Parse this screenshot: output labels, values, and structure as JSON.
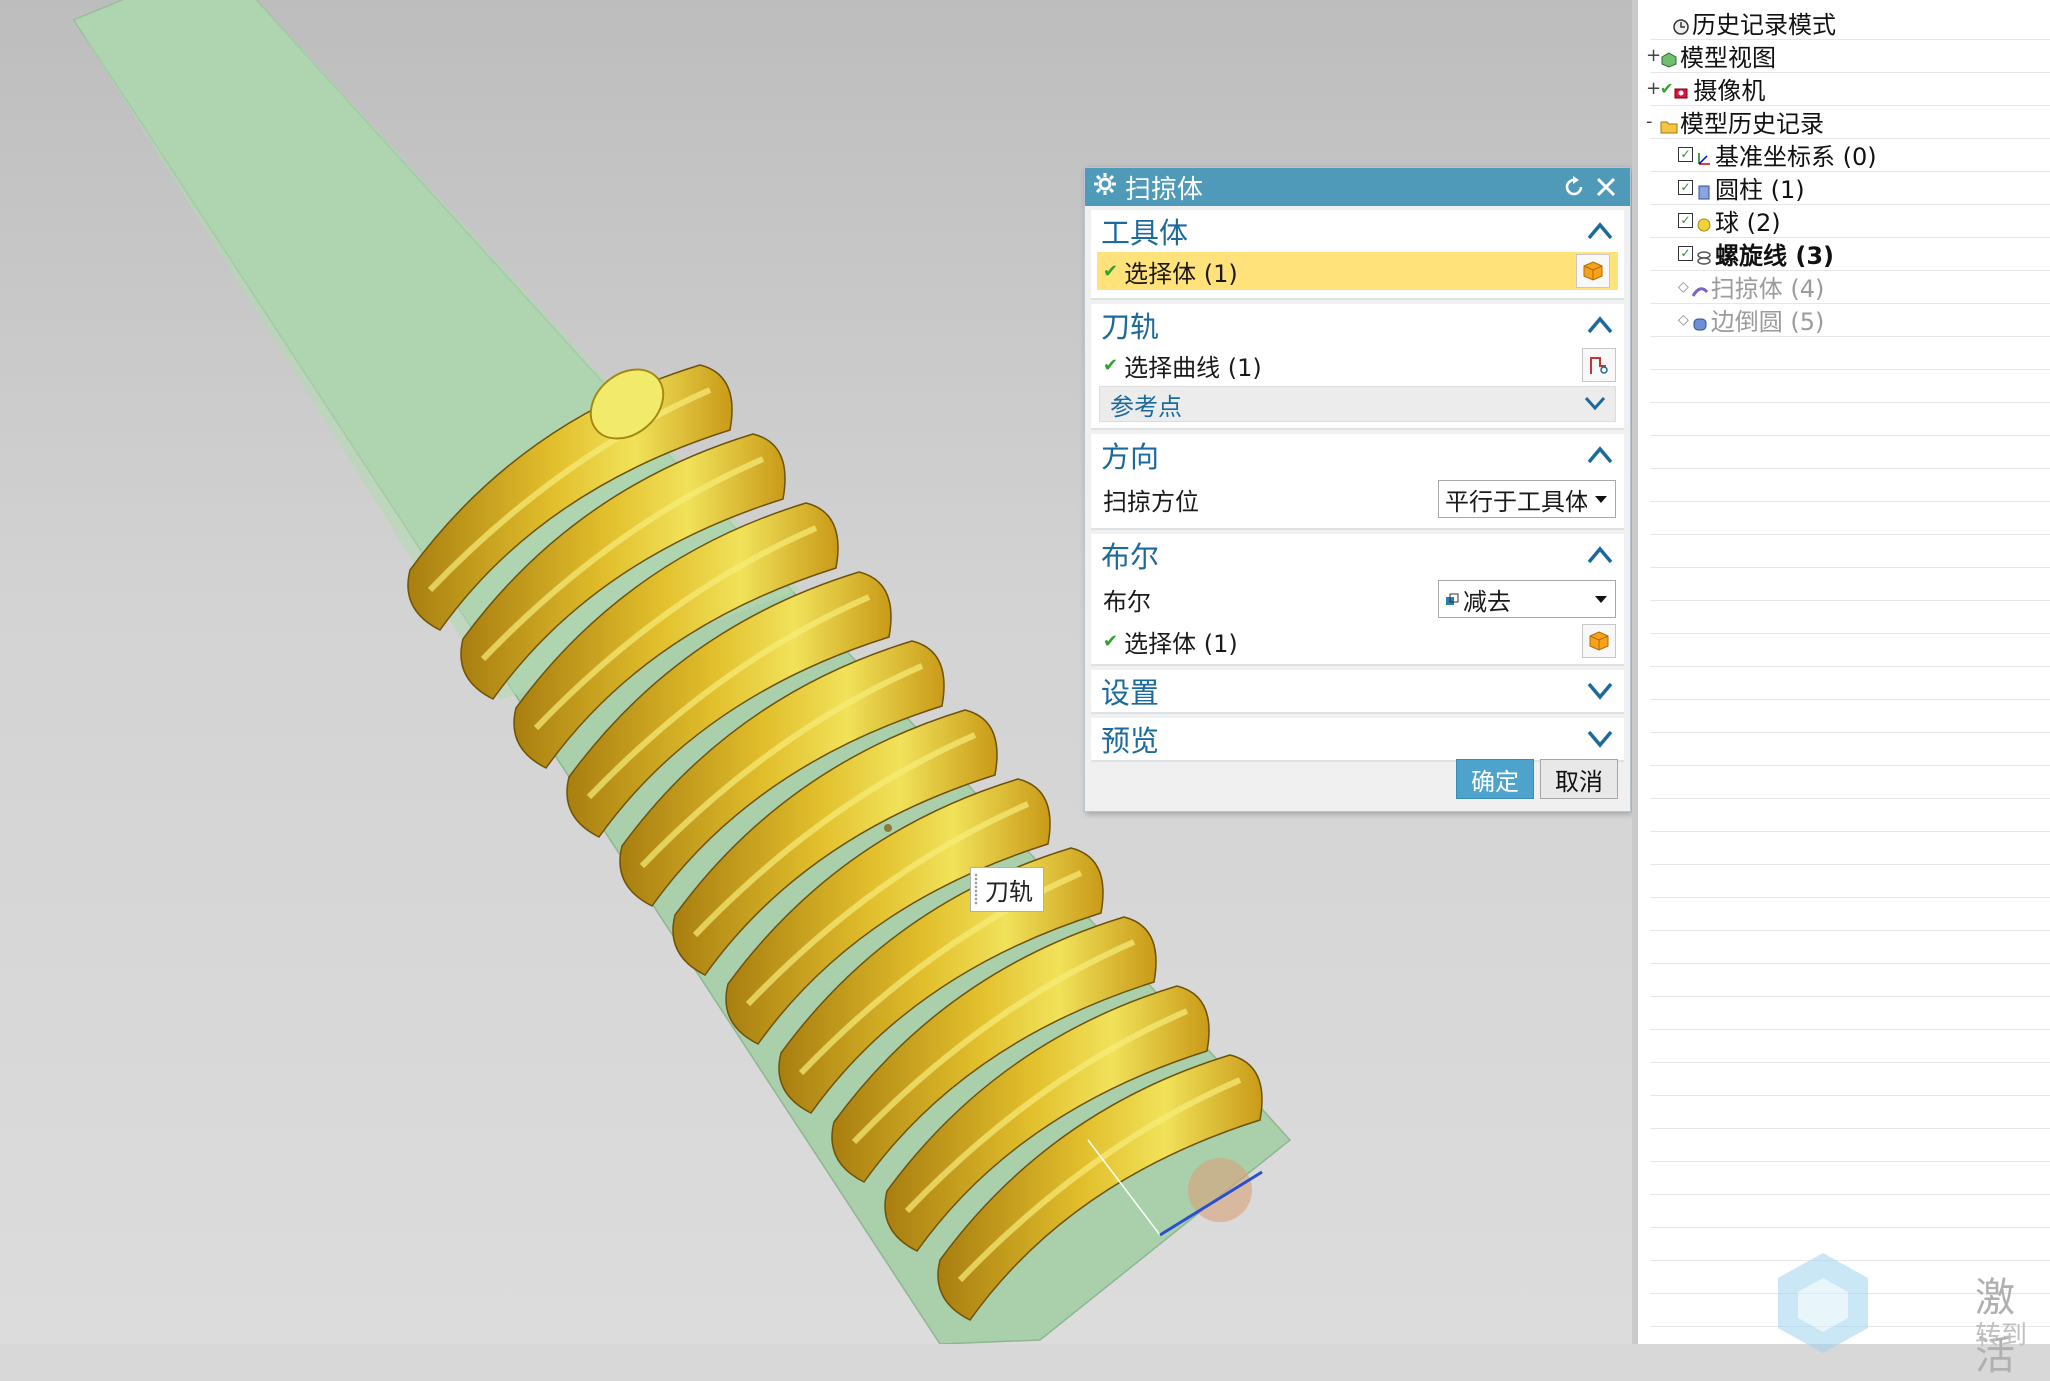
{
  "dialog": {
    "title": "扫掠体",
    "sections": {
      "tool_body": {
        "label": "工具体",
        "select_label": "选择体 (1)"
      },
      "path": {
        "label": "刀轨",
        "select_label": "选择曲线 (1)",
        "sub_label": "参考点"
      },
      "direction": {
        "label": "方向",
        "orient_label": "扫掠方位",
        "orient_value": "平行于工具体"
      },
      "boolean": {
        "label": "布尔",
        "bool_label": "布尔",
        "bool_value": "减去",
        "select_label": "选择体 (1)"
      },
      "settings": {
        "label": "设置"
      },
      "preview": {
        "label": "预览"
      }
    },
    "ok_label": "确定",
    "cancel_label": "取消"
  },
  "viewport": {
    "label": "刀轨",
    "colors": {
      "cylinder": "#a8cfa8",
      "thread": "#d8b32a"
    }
  },
  "navigator": {
    "items": [
      {
        "label": "历史记录模式",
        "icon": "clock-icon"
      },
      {
        "label": "模型视图",
        "icon": "views-icon",
        "expander": "+"
      },
      {
        "label": "摄像机",
        "icon": "camera-icon",
        "expander": "+"
      },
      {
        "label": "模型历史记录",
        "icon": "folder-icon",
        "expander": "-"
      },
      {
        "label": "基准坐标系 (0)",
        "icon": "csys-icon"
      },
      {
        "label": "圆柱 (1)",
        "icon": "cylinder-icon"
      },
      {
        "label": "球 (2)",
        "icon": "sphere-icon"
      },
      {
        "label": "螺旋线 (3)",
        "icon": "helix-icon"
      },
      {
        "label": "扫掠体 (4)",
        "icon": "sweep-icon"
      },
      {
        "label": "边倒圆 (5)",
        "icon": "blend-icon"
      }
    ]
  },
  "watermark": {
    "line1": "激活",
    "line2": "转到"
  }
}
